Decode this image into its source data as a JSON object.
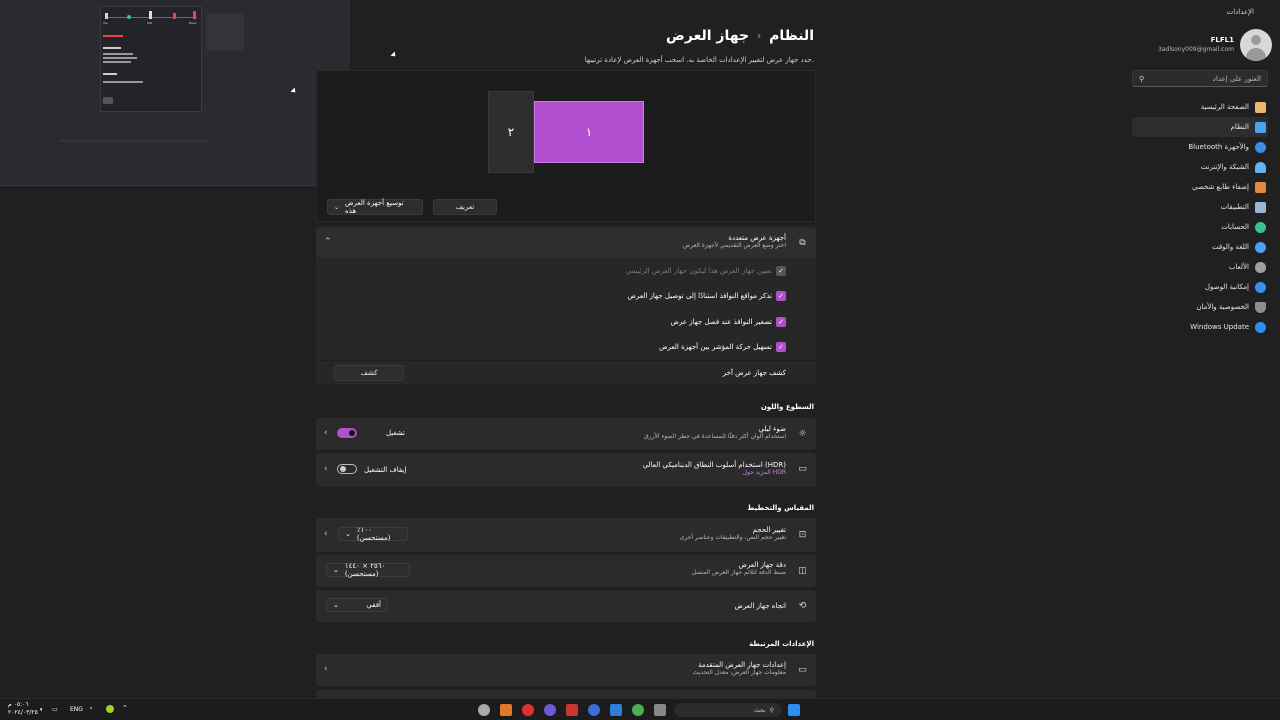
{
  "window": {
    "title": "الإعدادات"
  },
  "profile": {
    "name": "FLFL1",
    "email": "3adlsony009@gmail.com"
  },
  "search": {
    "placeholder": "العثور على إعداد"
  },
  "nav": {
    "items": [
      {
        "label": "الصفحة الرئيسية",
        "icon": "home-icon",
        "color": "#e9b96e"
      },
      {
        "label": "النظام",
        "icon": "monitor-icon",
        "color": "#4aa3f0",
        "active": true
      },
      {
        "label": "Bluetooth والأجهزة",
        "icon": "bluetooth-icon",
        "color": "#3d8ee8"
      },
      {
        "label": "الشبكة والإنترنت",
        "icon": "wifi-icon",
        "color": "#5fb4f5"
      },
      {
        "label": "إضفاء طابع شخصي",
        "icon": "brush-icon",
        "color": "#e08a3c"
      },
      {
        "label": "التطبيقات",
        "icon": "apps-icon",
        "color": "#9ab3d6"
      },
      {
        "label": "الحسابات",
        "icon": "person-icon",
        "color": "#3fc08f"
      },
      {
        "label": "اللغة والوقت",
        "icon": "globe-clock-icon",
        "color": "#4aa3f0"
      },
      {
        "label": "الألعاب",
        "icon": "gamepad-icon",
        "color": "#9aa0a6"
      },
      {
        "label": "إمكانية الوصول",
        "icon": "accessibility-icon",
        "color": "#3d8ee8"
      },
      {
        "label": "الخصوصية والأمان",
        "icon": "shield-icon",
        "color": "#8a8f96"
      },
      {
        "label": "Windows Update",
        "icon": "update-icon",
        "color": "#2f8ff0"
      }
    ]
  },
  "page": {
    "breadcrumb_parent": "النظام",
    "breadcrumb_sep": "›",
    "title": "جهاز العرض",
    "description": "حدد جهاز عرض لتغيير الإعدادات الخاصة به. اسحب أجهزة العرض لإعادة ترتيبها."
  },
  "arrange": {
    "monitor1": "١",
    "monitor2": "٢",
    "identify_button": "تعريف",
    "extend_select": "توسيع أجهزة العرض هذه"
  },
  "multi": {
    "title": "أجهزة عرض متعددة",
    "subtitle": "اختر وضع العرض التقديمي لأجهزة العرض",
    "main_display": "تعيين جهاز العرض هذا ليكون جهاز العرض الرئيسي",
    "remember_windows": "تذكر مواقع النوافذ استنادًا إلى توصيل جهاز العرض",
    "minimize_windows": "تصغير النوافذ عند فصل جهاز عرض",
    "ease_cursor": "تسهيل حركة المؤشر بين أجهزة العرض",
    "detect_label": "كشف جهاز عرض آخر",
    "detect_button": "كشف"
  },
  "brightness": {
    "section": "السطوع واللون",
    "night_title": "ضوء ليلي",
    "night_sub": "استخدام ألوان أكثر دفئًا للمساعدة في حظر الضوء الأزرق",
    "night_state": "تشغيل",
    "hdr_title": "استخدام أسلوب النطاق الديناميكي العالي (HDR)",
    "hdr_link": "المزيد حول HDR",
    "hdr_state": "إيقاف التشغيل"
  },
  "scale": {
    "section": "المقياس والتخطيط",
    "size_title": "تغيير الحجم",
    "size_sub": "تغيير حجم النص، والتطبيقات وعناصر أخرى",
    "size_value": "١٠٠٪ (مستحسن)",
    "res_title": "دقة جهاز العرض",
    "res_sub": "ضبط الدقة لتلائم جهاز العرض المتصل",
    "res_value": "٢٥٦٠ × ١٤٤٠ (مستحسن)",
    "orient_title": "اتجاه جهاز العرض",
    "orient_value": "أفقي"
  },
  "related": {
    "section": "الإعدادات المرتبطة",
    "adv_title": "إعدادات جهاز العرض المتقدمة",
    "adv_sub": "معلومات جهاز العرض، معدل التحديث"
  },
  "taskbar": {
    "search": "بحث",
    "lang": "ENG",
    "time": "٠٥:٠٦ م",
    "date": "٢٠٢٤/٠٣/٢٥"
  },
  "thumbnail": {
    "labels": [
      "Top",
      "Mid",
      "Base",
      "Default",
      "Mark",
      "Dark"
    ]
  }
}
